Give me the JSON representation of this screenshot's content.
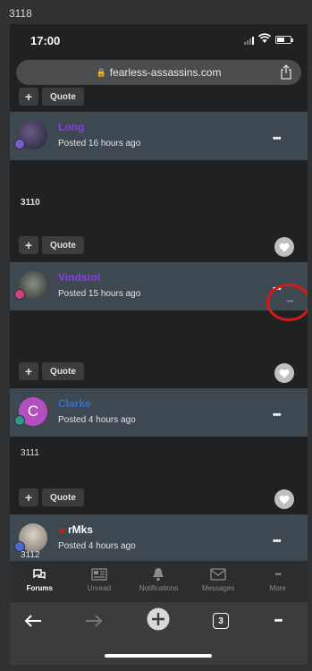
{
  "page_label": "3118",
  "status": {
    "time": "17:00"
  },
  "browser": {
    "url": "fearless-assassins.com",
    "tabs_count": "3"
  },
  "buttons": {
    "plus": "+",
    "quote": "Quote"
  },
  "posts": [
    {
      "username": "Long",
      "username_color": "#8a3ce8",
      "posted": "Posted 16 hours ago",
      "body": "3110"
    },
    {
      "username": "Vindstot",
      "username_color": "#8a3ce8",
      "posted": "Posted 15 hours ago",
      "body": ""
    },
    {
      "username": "Clarke",
      "username_color": "#2f6fd0",
      "posted": "Posted 4 hours ago",
      "body": "3111"
    },
    {
      "username": "rMks",
      "username_color": "#ffffff",
      "username_prefix": "★",
      "posted": "Posted 4 hours ago",
      "body": "3112"
    }
  ],
  "more_dots": "•••",
  "annotation_dots": "•••",
  "tabbar": [
    {
      "label": "Forums",
      "icon": "forums-icon",
      "active": true
    },
    {
      "label": "Unread",
      "icon": "newspaper-icon",
      "active": false
    },
    {
      "label": "Notifications",
      "icon": "bell-icon",
      "active": false
    },
    {
      "label": "Messages",
      "icon": "envelope-icon",
      "active": false
    },
    {
      "label": "More",
      "icon": "more-icon",
      "active": false
    }
  ]
}
